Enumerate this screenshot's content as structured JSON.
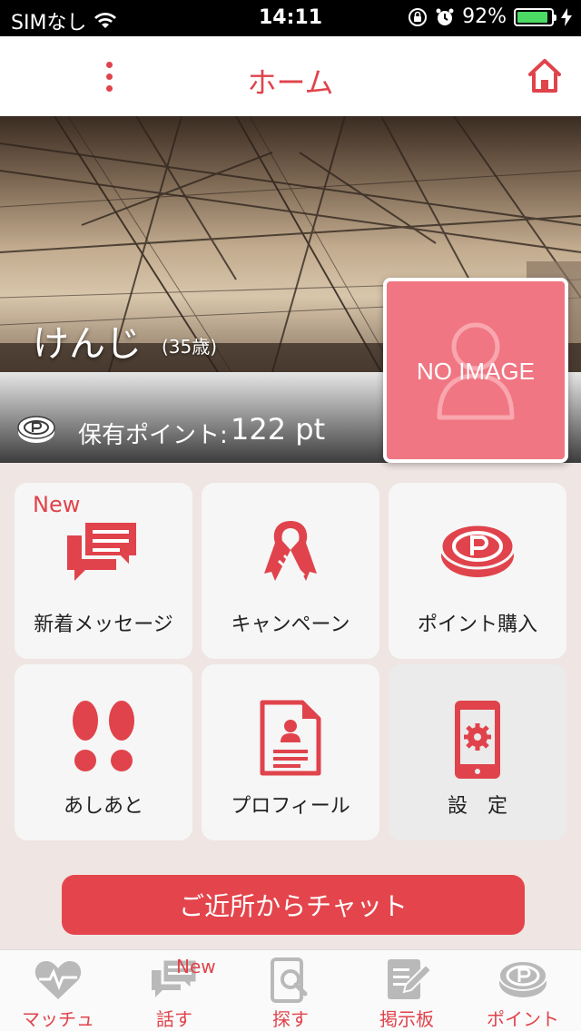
{
  "status_bar": {
    "carrier": "SIMなし",
    "time": "14:11",
    "battery": "92%",
    "battery_level": 0.92
  },
  "nav": {
    "title": "ホーム"
  },
  "profile": {
    "name": "けんじ",
    "age": "(35歳)",
    "points_label": "保有ポイント:",
    "points_value": "122 pt",
    "avatar_text": "NO IMAGE"
  },
  "menu": {
    "new_messages": {
      "label": "新着メッセージ",
      "badge": "New",
      "icon": "message-icon"
    },
    "campaign": {
      "label": "キャンペーン",
      "icon": "ribbon-icon"
    },
    "buy_points": {
      "label": "ポイント購入",
      "icon": "point-coin-icon"
    },
    "footprints": {
      "label": "あしあと",
      "icon": "footprints-icon"
    },
    "profile": {
      "label": "プロフィール",
      "icon": "profile-document-icon"
    },
    "settings": {
      "label": "設　定",
      "icon": "phone-gear-icon"
    }
  },
  "chat_button": "ご近所からチャット",
  "tabs": [
    {
      "label": "マッチュ",
      "icon": "heart-pulse-icon"
    },
    {
      "label": "話す",
      "icon": "chat-icon",
      "badge": "New"
    },
    {
      "label": "探す",
      "icon": "phone-search-icon"
    },
    {
      "label": "掲示板",
      "icon": "board-edit-icon"
    },
    {
      "label": "ポイント",
      "icon": "point-coin-icon"
    }
  ],
  "colors": {
    "accent": "#e0434b",
    "avatar_bg": "#f07683",
    "background": "#efe5e3"
  }
}
